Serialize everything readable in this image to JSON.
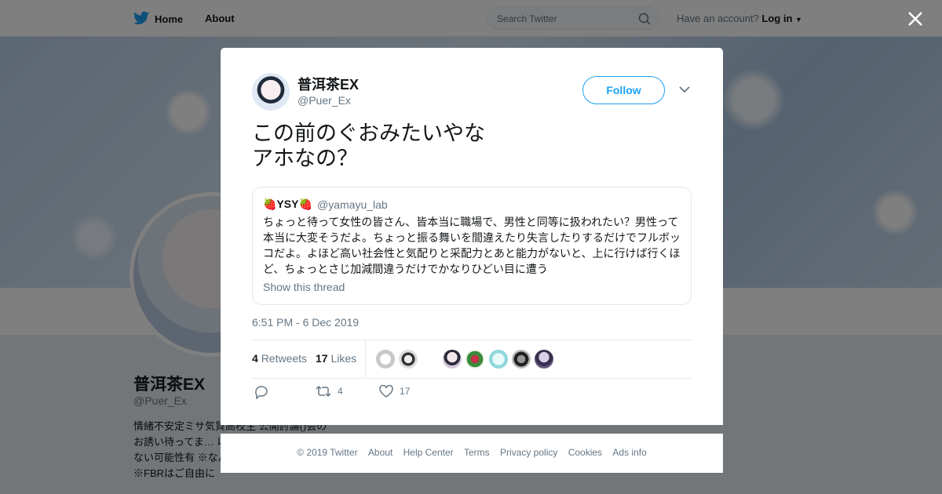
{
  "topbar": {
    "home_label": "Home",
    "about_label": "About",
    "search_placeholder": "Search Twitter",
    "account_prompt": "Have an account?",
    "login_label": "Log in"
  },
  "profile": {
    "name": "普洱茶EX",
    "handle": "@Puer_Ex",
    "bio": "情緒不安定ミサ気質高校生 公開討論()会のお誘い待ってま… 以外からは通知切… づかない可能性有 ※なんかあったらDMへ ※FBRはご自由に"
  },
  "tweet": {
    "author_name": "普洱茶EX",
    "author_handle": "@Puer_Ex",
    "follow_label": "Follow",
    "text": "この前のぐおみたいやな\nアホなの？",
    "quote": {
      "name": "🍓YSY🍓",
      "handle": "@yamayu_lab",
      "text": "ちょっと待って女性の皆さん、皆本当に職場で、男性と同等に扱われたい？男性って本当に大変そうだよ。ちょっと振る舞いを間違えたり失言したりするだけでフルボッコだよ。よほど高い社会性と気配りと采配力とあと能力がないと、上に行けば行くほど、ちょっとさじ加減間違うだけでかなりひどい目に遭う",
      "show_thread": "Show this thread"
    },
    "timestamp": "6:51 PM - 6 Dec 2019",
    "retweets_count": "4",
    "retweets_label": "Retweets",
    "likes_count": "17",
    "likes_label": "Likes",
    "action_retweet_count": "4",
    "action_like_count": "17"
  },
  "footer": {
    "links": [
      "© 2019 Twitter",
      "About",
      "Help Center",
      "Terms",
      "Privacy policy",
      "Cookies",
      "Ads info"
    ]
  },
  "colors": {
    "accent": "#1da1f2",
    "text": "#14171a",
    "muted": "#657786"
  }
}
